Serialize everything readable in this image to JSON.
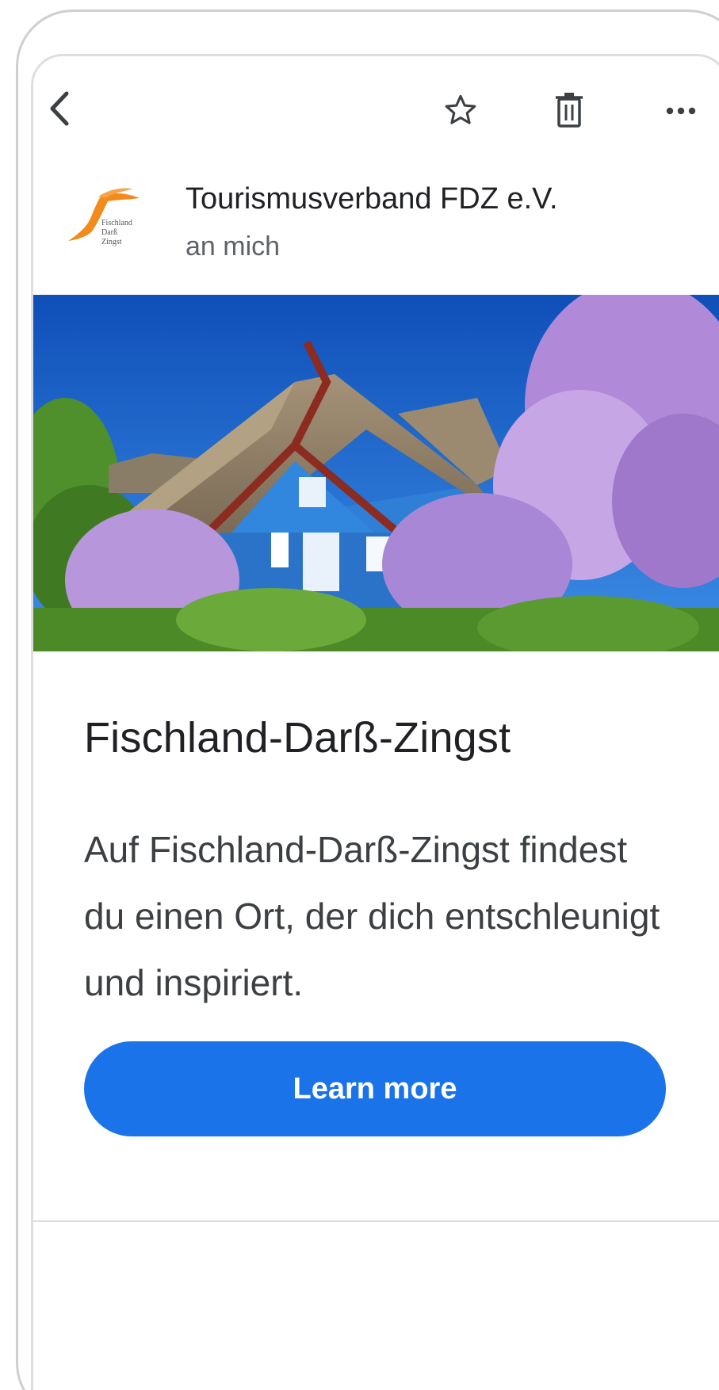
{
  "toolbar": {
    "back_icon": "chevron-left-icon",
    "star_icon": "star-outline-icon",
    "delete_icon": "trash-icon",
    "more_icon": "more-horizontal-icon"
  },
  "sender": {
    "name": "Tourismusverband FDZ e.V.",
    "recipient": "an mich",
    "logo_text": "Fischland Darß Zingst"
  },
  "message": {
    "headline": "Fischland-Darß-Zingst",
    "body": "Auf Fischland-Darß-Zingst findest du einen Ort, der dich entschleunigt und inspiriert.",
    "cta_label": "Learn more"
  },
  "colors": {
    "accent": "#1a73e8",
    "text_primary": "#202124",
    "text_secondary": "#5f6368",
    "logo_orange": "#f28a1c"
  }
}
